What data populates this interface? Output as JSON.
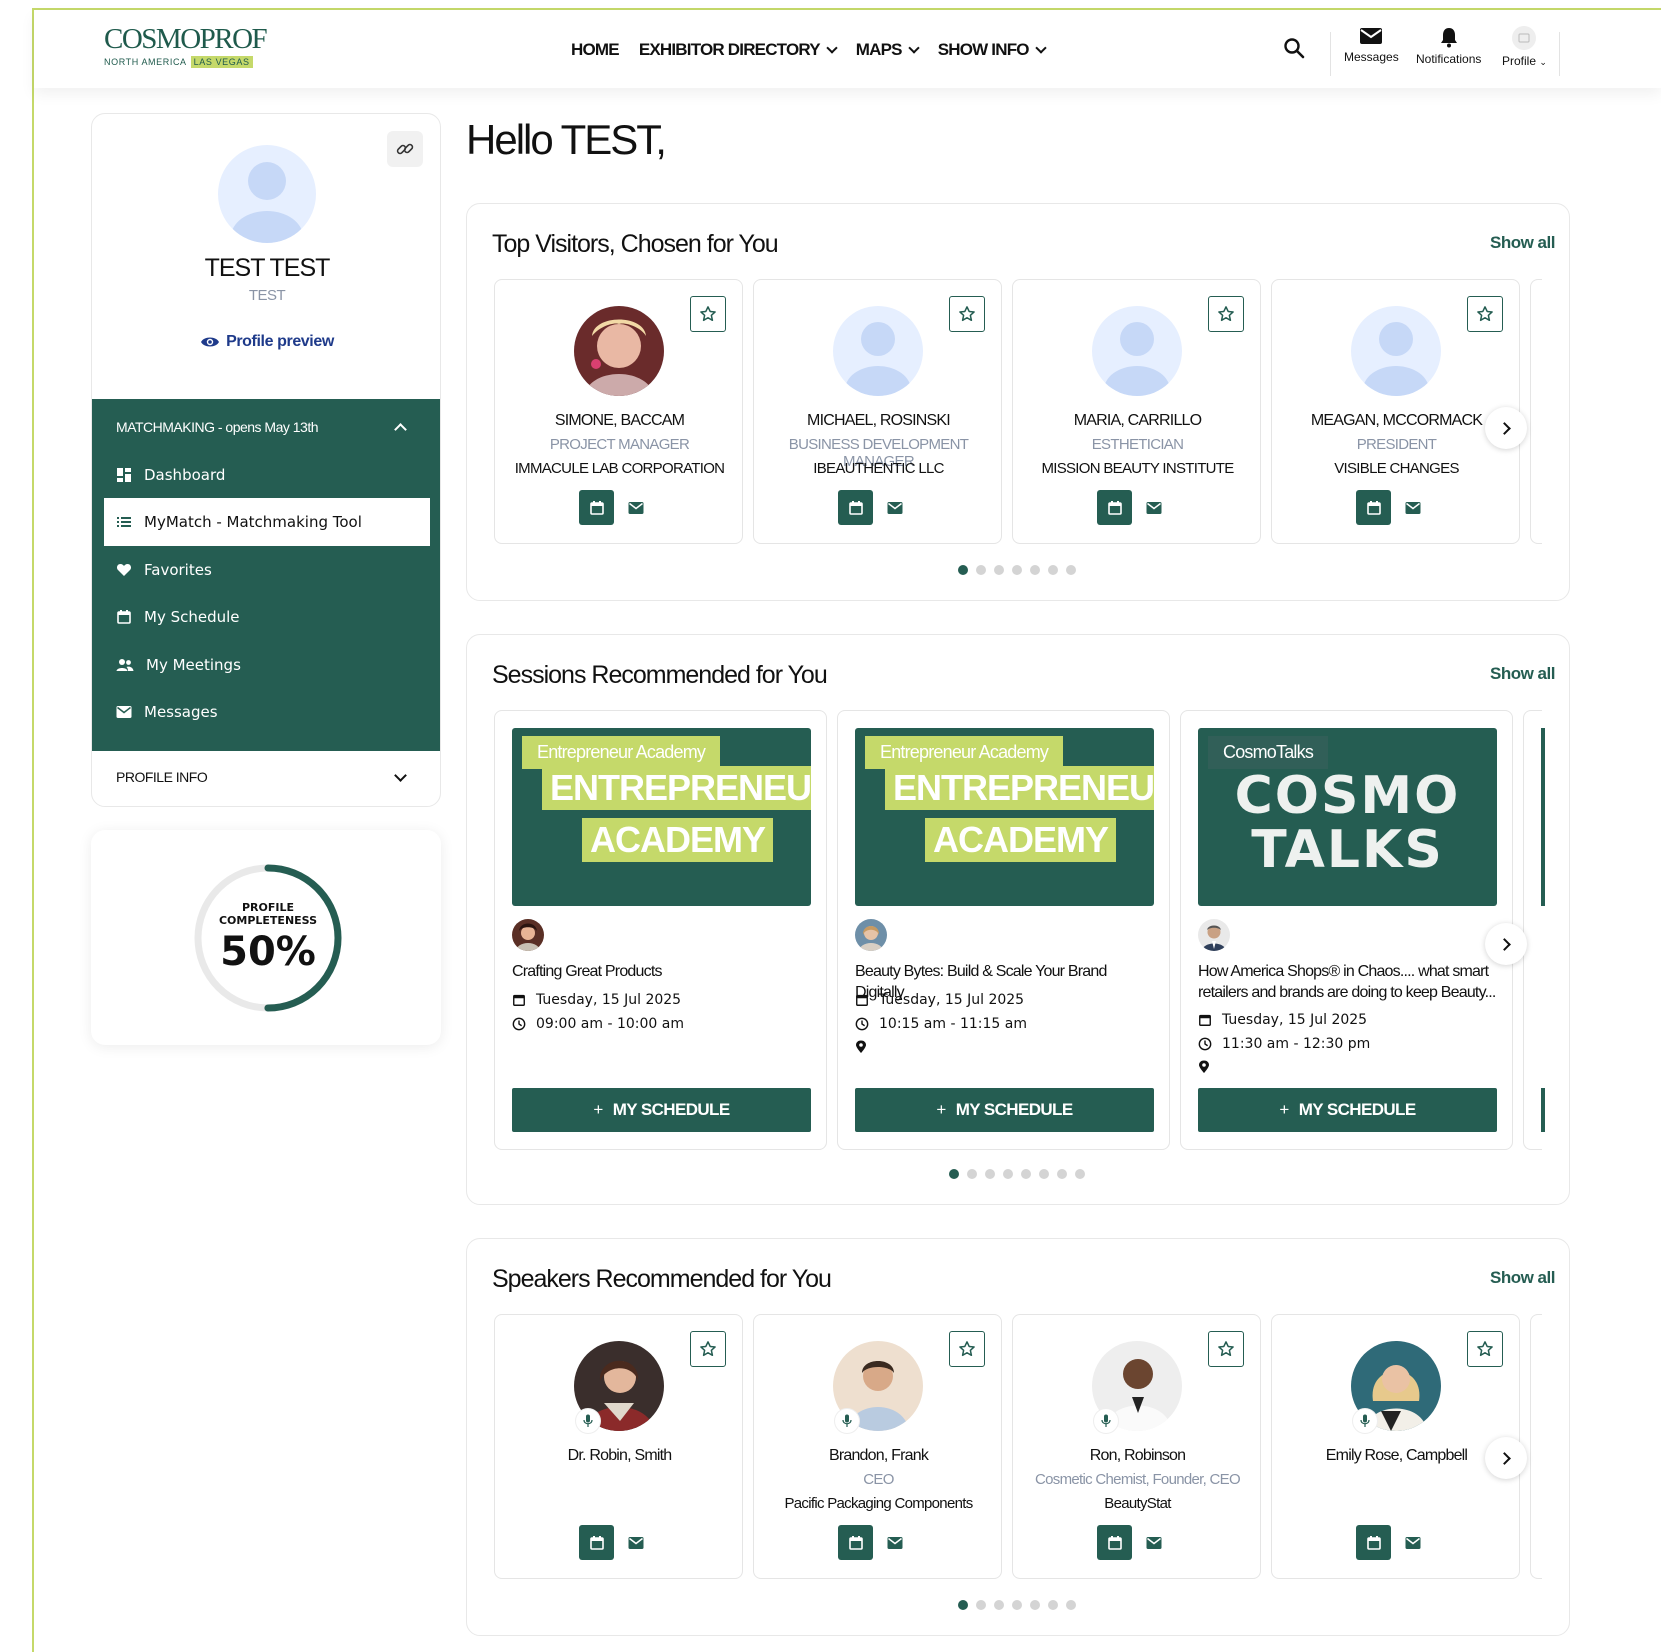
{
  "brand": {
    "logo_main": "COSMOPROF",
    "logo_sub_left": "NORTH AMERICA",
    "logo_sub_right": "LAS VEGAS",
    "accent": "#255d52",
    "lime": "#c5d96a"
  },
  "nav": {
    "items": [
      {
        "label": "HOME",
        "has_caret": false
      },
      {
        "label": "EXHIBITOR DIRECTORY",
        "has_caret": true
      },
      {
        "label": "MAPS",
        "has_caret": true
      },
      {
        "label": "SHOW INFO",
        "has_caret": true
      }
    ],
    "search_icon": "search-icon",
    "messages": "Messages",
    "notifications": "Notifications",
    "profile": "Profile"
  },
  "sidebar": {
    "name": "TEST TEST",
    "subtitle": "TEST",
    "preview": "Profile preview",
    "menu_heading": "MATCHMAKING - opens May 13th",
    "menu_items": [
      {
        "label": "Dashboard",
        "icon": "dashboard-icon",
        "active": false
      },
      {
        "label": "MyMatch - Matchmaking Tool",
        "icon": "list-icon",
        "active": true
      },
      {
        "label": "Favorites",
        "icon": "heart-icon",
        "active": false
      },
      {
        "label": "My Schedule",
        "icon": "calendar-icon",
        "active": false
      },
      {
        "label": "My Meetings",
        "icon": "meetings-icon",
        "active": false
      },
      {
        "label": "Messages",
        "icon": "mail-icon",
        "active": false
      }
    ],
    "profile_info": "PROFILE INFO",
    "completeness_label_1": "PROFILE",
    "completeness_label_2": "COMPLETENESS",
    "completeness_value": "50%",
    "completeness_fraction": 0.5
  },
  "greeting": "Hello TEST,",
  "visitors": {
    "title": "Top Visitors, Chosen for You",
    "show_all": "Show all",
    "cards": [
      {
        "name": "SIMONE, BACCAM",
        "title": "PROJECT MANAGER",
        "company": "IMMACULE LAB CORPORATION",
        "photo": true
      },
      {
        "name": "MICHAEL, ROSINSKI",
        "title": "BUSINESS DEVELOPMENT MANAGER",
        "company": "IBEAUTHENTIC LLC",
        "photo": false
      },
      {
        "name": "MARIA, CARRILLO",
        "title": "ESTHETICIAN",
        "company": "MISSION BEAUTY INSTITUTE",
        "photo": false
      },
      {
        "name": "MEAGAN, MCCORMACK",
        "title": "PRESIDENT",
        "company": "VISIBLE CHANGES",
        "photo": false
      }
    ],
    "dots": 7,
    "active_dot": 0
  },
  "sessions": {
    "title": "Sessions Recommended for You",
    "show_all": "Show all",
    "button_label": "MY SCHEDULE",
    "cards": [
      {
        "tag": "Entrepreneur Academy",
        "banner_1": "ENTREPRENEUR",
        "banner_2": "ACADEMY",
        "type": "ea",
        "title": "Crafting Great Products",
        "date": "Tuesday, 15 Jul 2025",
        "time": "09:00 am - 10:00 am",
        "has_location": false
      },
      {
        "tag": "Entrepreneur Academy",
        "banner_1": "ENTREPRENEUR",
        "banner_2": "ACADEMY",
        "type": "ea",
        "title": "Beauty Bytes: Build & Scale Your Brand Digitally",
        "date": "Tuesday, 15 Jul 2025",
        "time": "10:15 am - 11:15 am",
        "has_location": true
      },
      {
        "tag": "CosmoTalks",
        "banner_1": "COSMO",
        "banner_2": "TALKS",
        "type": "ct",
        "title": "How America Shops® in Chaos.... what smart retailers and brands are doing to keep Beauty...",
        "date": "Tuesday, 15 Jul 2025",
        "time": "11:30 am - 12:30 pm",
        "has_location": true
      }
    ],
    "dots": 8,
    "active_dot": 0
  },
  "speakers": {
    "title": "Speakers Recommended for You",
    "show_all": "Show all",
    "cards": [
      {
        "name": "Dr. Robin, Smith",
        "title": "",
        "company": ""
      },
      {
        "name": "Brandon, Frank",
        "title": "CEO",
        "company": "Pacific Packaging Components"
      },
      {
        "name": "Ron, Robinson",
        "title": "Cosmetic Chemist, Founder, CEO",
        "company": "BeautyStat"
      },
      {
        "name": "Emily Rose, Campbell",
        "title": "",
        "company": ""
      }
    ],
    "dots": 7,
    "active_dot": 0
  }
}
